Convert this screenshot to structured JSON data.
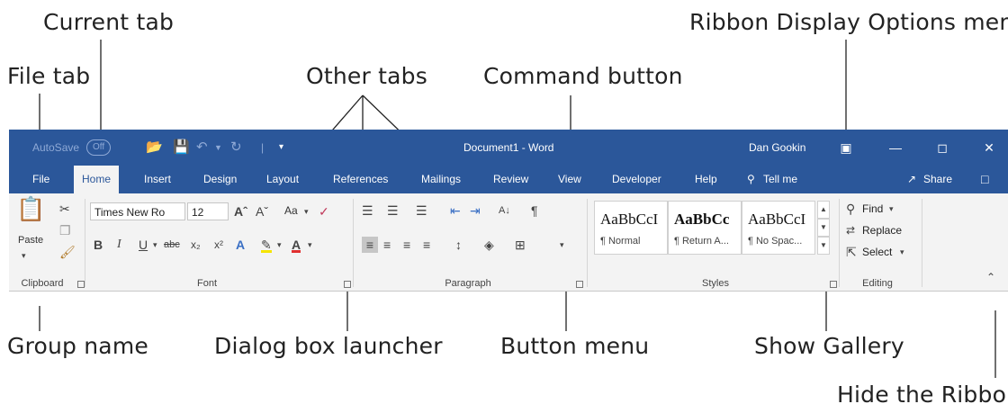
{
  "callouts": {
    "current_tab": "Current tab",
    "file_tab": "File tab",
    "other_tabs": "Other tabs",
    "command_button": "Command button",
    "ribbon_display_options": "Ribbon Display Options menu",
    "group_name": "Group name",
    "dialog_box_launcher": "Dialog box launcher",
    "button_menu": "Button menu",
    "show_gallery": "Show Gallery",
    "hide_ribbon": "Hide the Ribbon"
  },
  "titlebar": {
    "autosave": "AutoSave",
    "autosave_state": "Off",
    "document_title": "Document1 - Word",
    "user": "Dan Gookin"
  },
  "tabs": [
    "File",
    "Home",
    "Insert",
    "Design",
    "Layout",
    "References",
    "Mailings",
    "Review",
    "View",
    "Developer",
    "Help"
  ],
  "tell_me": "Tell me",
  "share": "Share",
  "font": {
    "name": "Times New Ro",
    "size": "12",
    "case_label": "Aa"
  },
  "clipboard": {
    "paste_label": "Paste"
  },
  "styles": [
    {
      "sample": "AaBbCcI",
      "label": "¶ Normal"
    },
    {
      "sample": "AaBbCc",
      "label": "¶ Return A..."
    },
    {
      "sample": "AaBbCcI",
      "label": "¶ No Spac..."
    }
  ],
  "editing": {
    "find": "Find",
    "replace": "Replace",
    "select": "Select"
  },
  "groups": {
    "clipboard": "Clipboard",
    "font": "Font",
    "paragraph": "Paragraph",
    "styles": "Styles",
    "editing": "Editing"
  },
  "colors": {
    "ribbon_blue": "#2b579a",
    "ribbon_bg": "#f3f3f3"
  }
}
